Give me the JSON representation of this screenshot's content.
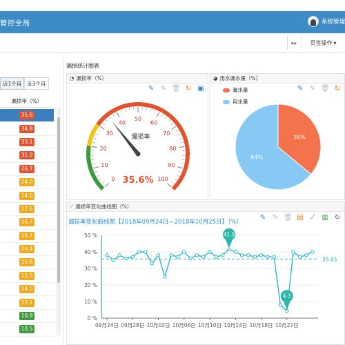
{
  "header": {
    "title": "管控全局",
    "user_name": "系统管理"
  },
  "toolbar": {
    "nav_icon": "double-chevron-right-icon",
    "tab_ops_label": "页签操作",
    "tab_ops_icon": "caret-down-icon"
  },
  "left": {
    "tabs": [
      "近1个月",
      "近3个月"
    ],
    "active_tab": 0,
    "column_header": "漏损率（%）",
    "values": [
      "35.6",
      "34.8",
      "33.1",
      "31.9",
      "26.7",
      "24.0",
      "24.0",
      "17.6",
      "16.7",
      "16.7",
      "16.4",
      "15.8",
      "15.5",
      "14.5",
      "13.1",
      "10.9",
      "10.5"
    ],
    "colors": [
      "#e0542f",
      "#e0542f",
      "#e0542f",
      "#e0542f",
      "#e0542f",
      "#f0a91c",
      "#f0a91c",
      "#f0a91c",
      "#f0a91c",
      "#f0a91c",
      "#f0a91c",
      "#f0a91c",
      "#f0a91c",
      "#f0a91c",
      "#f0a91c",
      "#3e9a3e",
      "#3e9a3e"
    ]
  },
  "main": {
    "panel_title": "漏损统计图表",
    "gauge": {
      "card_title": "漏损率（%）",
      "label": "漏损率",
      "value": 35.6,
      "value_text": "35.6%",
      "ticks": [
        "0",
        "10",
        "20",
        "30",
        "40",
        "50",
        "60",
        "70",
        "80",
        "90",
        "100"
      ],
      "tools": [
        "pencil-icon",
        "pencil-outline-icon",
        "trash-icon",
        "refresh-icon",
        "save-icon"
      ]
    },
    "pie": {
      "card_title": "用水漏水量（%）",
      "legend": [
        "漏水量",
        "用水量"
      ],
      "colors": [
        "#f5734c",
        "#87c8f5"
      ],
      "slices": [
        {
          "name": "漏水量",
          "value": 36,
          "label": "36%"
        },
        {
          "name": "用水量",
          "value": 64,
          "label": "64%"
        }
      ],
      "tools": [
        "pencil-icon",
        "pencil-outline-icon",
        "trash-icon",
        "refresh-icon"
      ]
    },
    "line": {
      "card_title": "漏损率变化曲线图（%）",
      "chart_title": "漏损率变化曲线图【2018年09月24日—2018年10月25日】（%）",
      "tools": [
        "pencil-icon",
        "pencil-outline-icon",
        "trash-icon",
        "table-icon",
        "line-chart-icon",
        "bar-chart-icon",
        "refresh-icon"
      ]
    }
  },
  "chart_data": {
    "type": "line",
    "title": "漏损率变化曲线图【2018年09月24日—2018年10月25日】（%）",
    "x_ticks": [
      "09月24日",
      "09月28日",
      "10月02日",
      "10月06日",
      "10月10日",
      "10月14日",
      "10月18日",
      "10月22日"
    ],
    "y_ticks": [
      "0 %",
      "10 %",
      "20 %",
      "30 %",
      "40 %",
      "50 %"
    ],
    "ylim": [
      0,
      50
    ],
    "series": [
      {
        "values": [
          38,
          35,
          38,
          36,
          37,
          40,
          40,
          33,
          38,
          25,
          38,
          37,
          40,
          36,
          38,
          37,
          40,
          37,
          38,
          41.5,
          40,
          38,
          38,
          37,
          38,
          37,
          37,
          8,
          4.3,
          40,
          37,
          38,
          40
        ]
      }
    ],
    "average": 35.65,
    "average_label": "35.65",
    "max_label": "41.5",
    "min_label": "4.3",
    "grid": true
  }
}
